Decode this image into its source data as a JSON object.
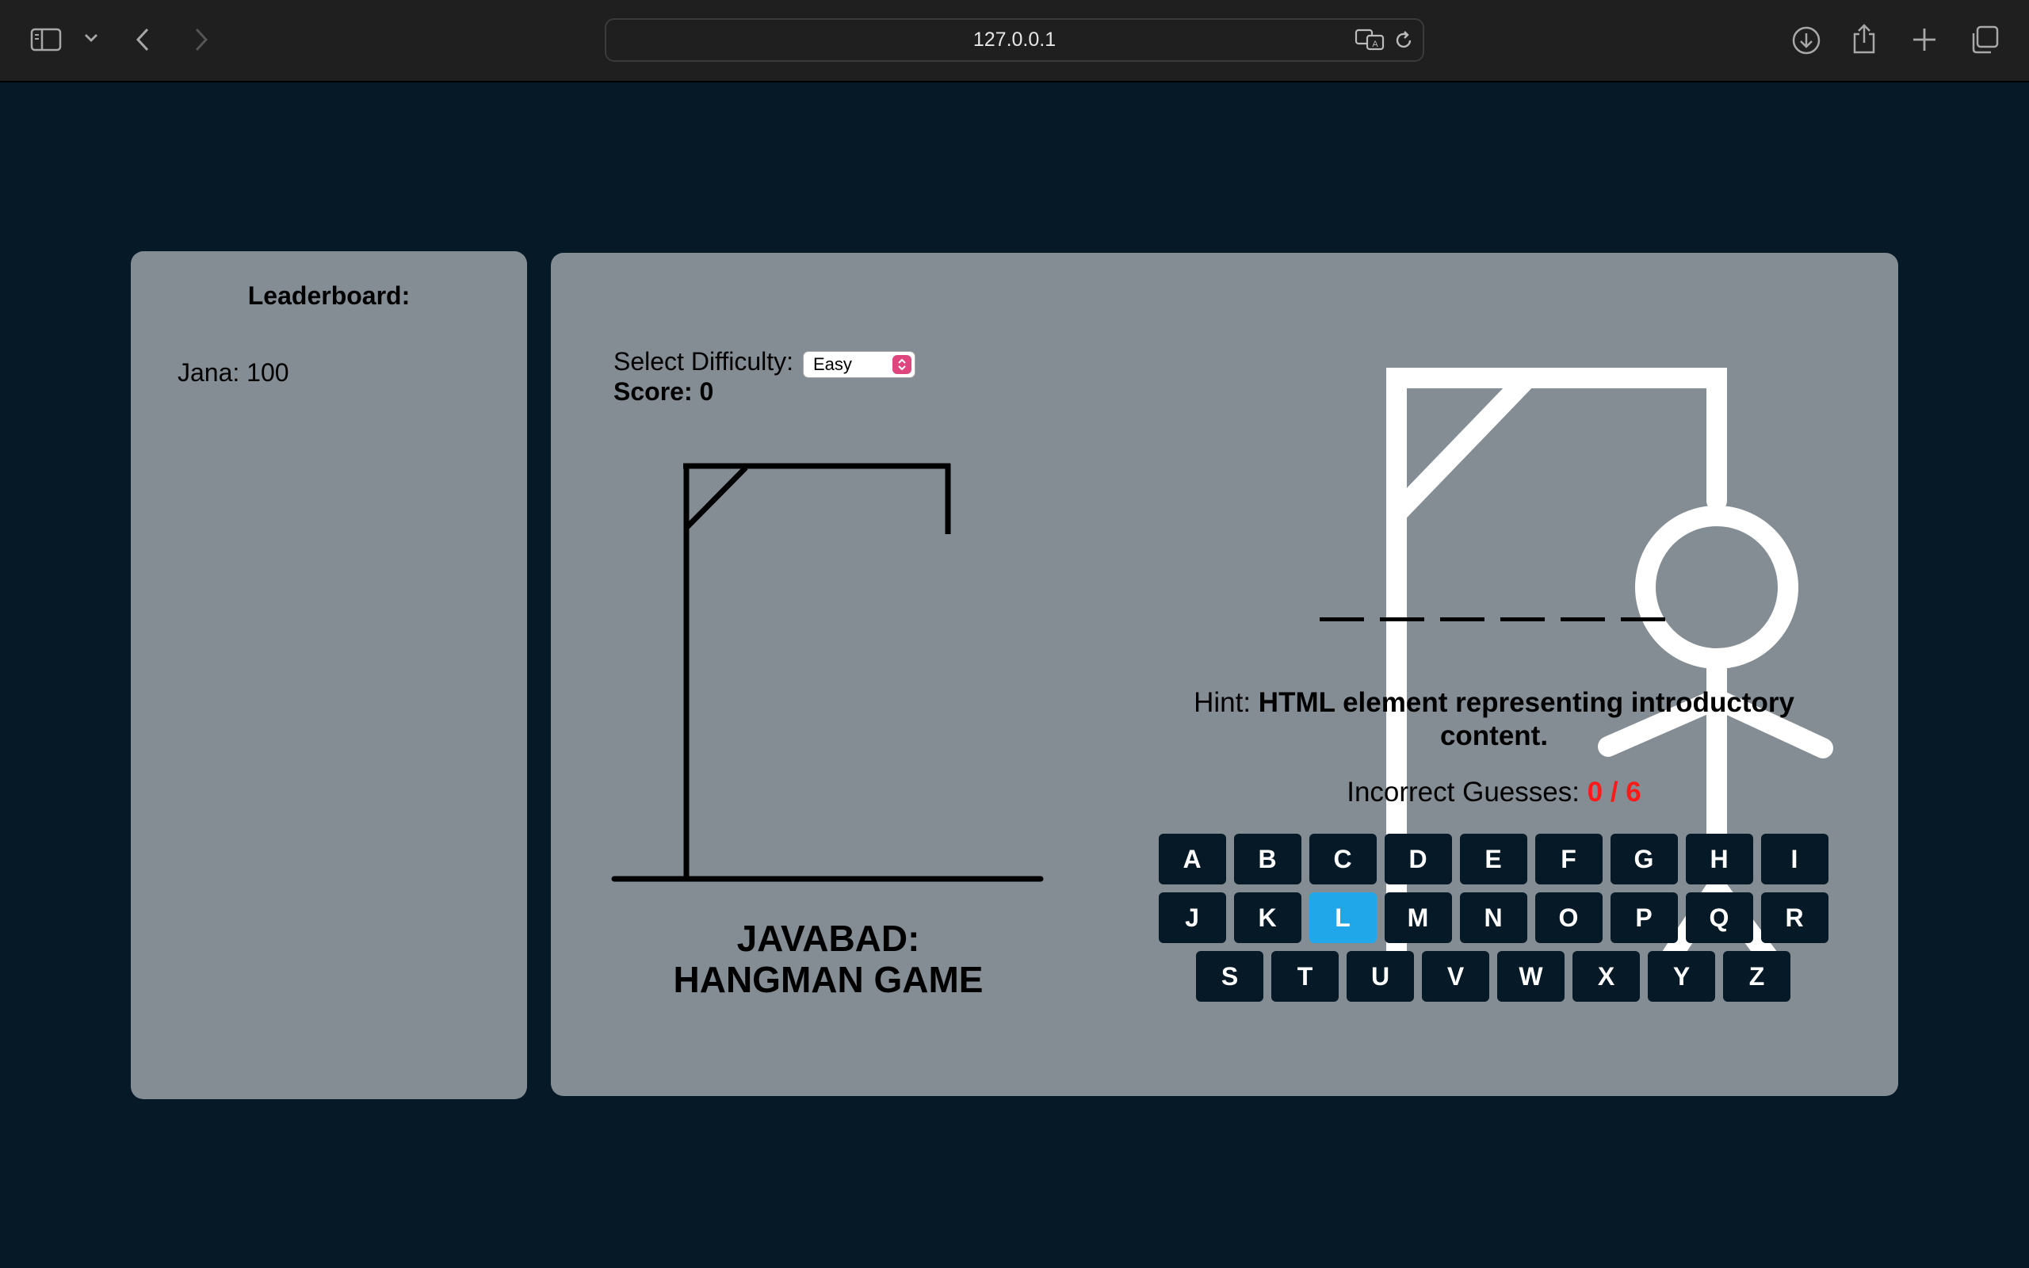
{
  "browser": {
    "url": "127.0.0.1"
  },
  "icons": {
    "sidebar": "sidebar-icon",
    "dropdown": "chevron-down-icon",
    "back": "chevron-left-icon",
    "forward": "chevron-right-icon",
    "translate": "translate-icon",
    "reload": "reload-icon",
    "download": "download-icon",
    "share": "share-icon",
    "new_tab": "plus-icon",
    "tabs": "tabs-overview-icon"
  },
  "leaderboard": {
    "title": "Leaderboard:",
    "entries": [
      "Jana: 100"
    ]
  },
  "game": {
    "difficulty_label": "Select Difficulty:",
    "difficulty_value": "Easy",
    "score_text": "Score: 0",
    "title_line1": "JAVABAD:",
    "title_line2": "HANGMAN GAME",
    "hint_prefix": "Hint: ",
    "hint_text": "HTML element representing introductory content.",
    "incorrect_label": "Incorrect Guesses: ",
    "incorrect_count": "0 / 6",
    "blank_count": 6
  },
  "keyboard": {
    "rows": [
      [
        "A",
        "B",
        "C",
        "D",
        "E",
        "F",
        "G",
        "H",
        "I"
      ],
      [
        "J",
        "K",
        "L",
        "M",
        "N",
        "O",
        "P",
        "Q",
        "R"
      ],
      [
        "S",
        "T",
        "U",
        "V",
        "W",
        "X",
        "Y",
        "Z"
      ]
    ],
    "active_key": "L"
  },
  "colors": {
    "page_bg": "#061927",
    "panel_bg": "#848c94",
    "key_bg": "#061927",
    "key_active": "#1fa7ea",
    "incorrect_count": "#ff1a1a",
    "select_arrow": "#e0467e"
  }
}
